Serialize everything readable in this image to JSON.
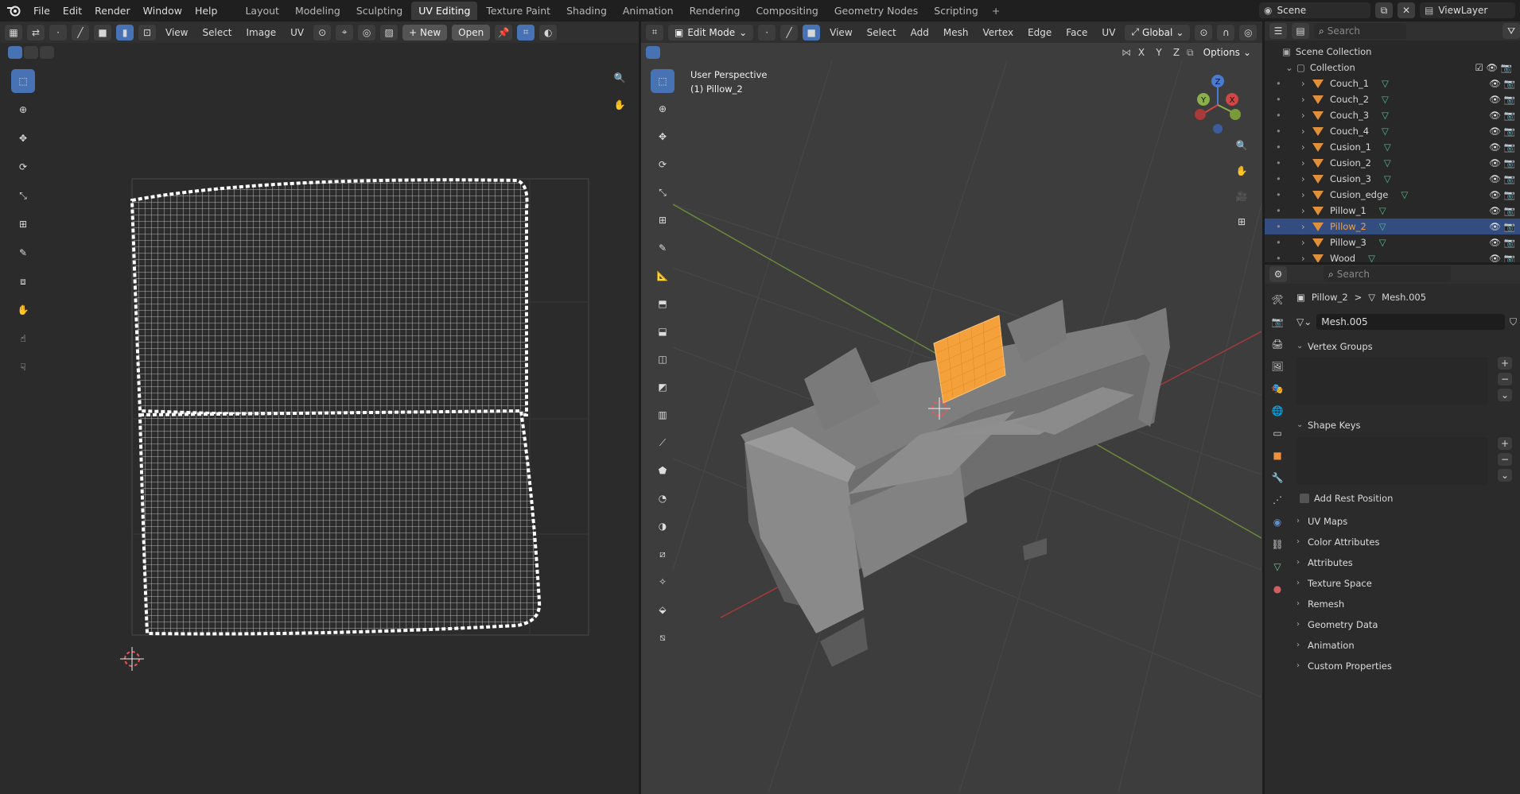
{
  "topbar": {
    "menus": [
      "File",
      "Edit",
      "Render",
      "Window",
      "Help"
    ],
    "workspaces": [
      "Layout",
      "Modeling",
      "Sculpting",
      "UV Editing",
      "Texture Paint",
      "Shading",
      "Animation",
      "Rendering",
      "Compositing",
      "Geometry Nodes",
      "Scripting"
    ],
    "active_workspace": "UV Editing",
    "plus": "+",
    "scene_name": "Scene",
    "viewlayer_name": "ViewLayer"
  },
  "uv_editor": {
    "menus": [
      "View",
      "Select",
      "Image",
      "UV"
    ],
    "new_label": "+ New",
    "open_label": "Open"
  },
  "viewport": {
    "mode": "Edit Mode",
    "menus": [
      "View",
      "Select",
      "Add",
      "Mesh",
      "Vertex",
      "Edge",
      "Face",
      "UV"
    ],
    "orientation": "Global",
    "axis_x": "X",
    "axis_y": "Y",
    "axis_z": "Z",
    "options_label": "Options",
    "perspective_label": "User Perspective",
    "object_label": "(1) Pillow_2",
    "colors": {
      "selected_object": "#f5a13b",
      "mesh": "#8a8a8a"
    }
  },
  "outliner": {
    "search_placeholder": "Search",
    "scene_collection": "Scene Collection",
    "collection": "Collection",
    "items": [
      {
        "name": "Couch_1",
        "selected": false
      },
      {
        "name": "Couch_2",
        "selected": false
      },
      {
        "name": "Couch_3",
        "selected": false
      },
      {
        "name": "Couch_4",
        "selected": false
      },
      {
        "name": "Cusion_1",
        "selected": false
      },
      {
        "name": "Cusion_2",
        "selected": false
      },
      {
        "name": "Cusion_3",
        "selected": false
      },
      {
        "name": "Cusion_edge",
        "selected": false
      },
      {
        "name": "Pillow_1",
        "selected": false
      },
      {
        "name": "Pillow_2",
        "selected": true
      },
      {
        "name": "Pillow_3",
        "selected": false
      },
      {
        "name": "Wood",
        "selected": false
      }
    ]
  },
  "properties": {
    "search_placeholder": "Search",
    "breadcrumb_object": "Pillow_2",
    "breadcrumb_sep": ">",
    "breadcrumb_mesh": "Mesh.005",
    "mesh_name": "Mesh.005",
    "vertex_groups": "Vertex Groups",
    "shape_keys": "Shape Keys",
    "add_rest_position": "Add Rest Position",
    "sections": [
      "UV Maps",
      "Color Attributes",
      "Attributes",
      "Texture Space",
      "Remesh",
      "Geometry Data",
      "Animation",
      "Custom Properties"
    ]
  }
}
